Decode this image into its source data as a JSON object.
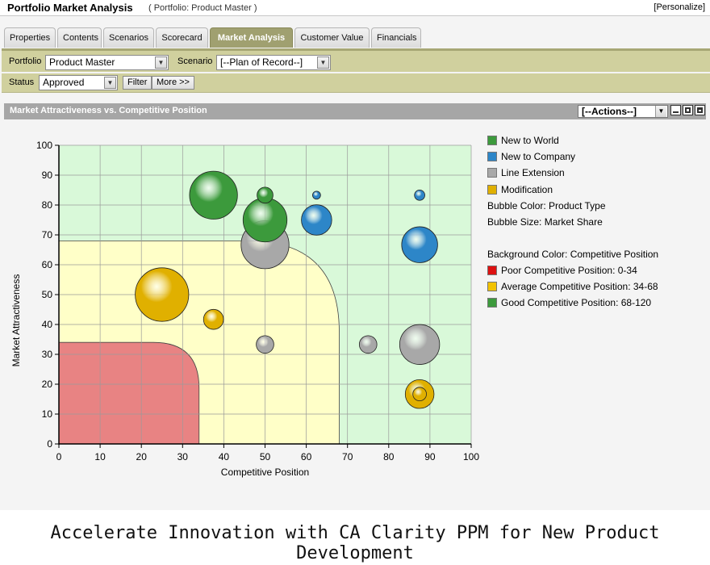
{
  "header": {
    "title": "Portfolio Market Analysis",
    "subtitle": "( Portfolio: Product Master )",
    "personalize": "[Personalize]"
  },
  "tabs": [
    {
      "label": "Properties"
    },
    {
      "label": "Contents"
    },
    {
      "label": "Scenarios"
    },
    {
      "label": "Scorecard"
    },
    {
      "label": "Market Analysis",
      "active": true
    },
    {
      "label": "Customer Value"
    },
    {
      "label": "Financials"
    }
  ],
  "filters": {
    "portfolio_label": "Portfolio",
    "portfolio_value": "Product Master",
    "scenario_label": "Scenario",
    "scenario_value": "[--Plan of Record--]",
    "status_label": "Status",
    "status_value": "Approved",
    "filter_button": "Filter",
    "more_button": "More >>"
  },
  "portlet": {
    "title": "Market Attractiveness vs. Competitive Position",
    "actions_value": "[--Actions--]"
  },
  "legend": {
    "types": [
      {
        "label": "New to World",
        "color": "#3c9a3c"
      },
      {
        "label": "New to Company",
        "color": "#2d86c8"
      },
      {
        "label": "Line Extension",
        "color": "#a8a8a8"
      },
      {
        "label": "Modification",
        "color": "#e0b000"
      }
    ],
    "bubble_color_note": "Bubble Color: Product Type",
    "bubble_size_note": "Bubble Size: Market Share",
    "background_title": "Background Color: Competitive Position",
    "zones": [
      {
        "label": "Poor Competitive Position: 0-34",
        "color": "#dd1111"
      },
      {
        "label": "Average Competitive Position: 34-68",
        "color": "#f2c200"
      },
      {
        "label": "Good Competitive Position: 68-120",
        "color": "#3c9a3c"
      }
    ]
  },
  "chart_data": {
    "type": "scatter",
    "xlabel": "Competitive Position",
    "ylabel": "Market Attractiveness",
    "xlim": [
      0,
      100
    ],
    "ylim": [
      0,
      100
    ],
    "x_ticks": [
      0,
      10,
      20,
      30,
      40,
      50,
      60,
      70,
      80,
      90,
      100
    ],
    "y_ticks": [
      0,
      10,
      20,
      30,
      40,
      50,
      60,
      70,
      80,
      90,
      100
    ],
    "grid": true,
    "legend_position": "right",
    "background_zones": [
      {
        "label": "Poor Competitive Position: 0-34",
        "max": 34,
        "color": "#e88383"
      },
      {
        "label": "Average Competitive Position: 34-68",
        "max": 68,
        "color": "#ffffc8"
      },
      {
        "label": "Good Competitive Position: 68-120",
        "max": 120,
        "color": "#d9f9d9"
      }
    ],
    "series": [
      {
        "name": "New to World",
        "color": "#3c9a3c",
        "points": [
          {
            "x": 37.5,
            "y": 83.3,
            "size": 6.0
          },
          {
            "x": 50,
            "y": 83.3,
            "size": 2.0
          },
          {
            "x": 50,
            "y": 75,
            "size": 5.5
          }
        ]
      },
      {
        "name": "New to Company",
        "color": "#2d86c8",
        "points": [
          {
            "x": 62.5,
            "y": 83.3,
            "size": 1.0
          },
          {
            "x": 62.5,
            "y": 75,
            "size": 3.8
          },
          {
            "x": 87.5,
            "y": 83.3,
            "size": 1.3
          },
          {
            "x": 87.5,
            "y": 66.7,
            "size": 4.5
          }
        ]
      },
      {
        "name": "Line Extension",
        "color": "#a8a8a8",
        "points": [
          {
            "x": 50,
            "y": 66.7,
            "size": 6.0
          },
          {
            "x": 50,
            "y": 33.3,
            "size": 2.2
          },
          {
            "x": 75,
            "y": 33.3,
            "size": 2.2
          },
          {
            "x": 87.5,
            "y": 33.3,
            "size": 5.0
          }
        ]
      },
      {
        "name": "Modification",
        "color": "#e0b000",
        "points": [
          {
            "x": 25,
            "y": 50,
            "size": 6.7
          },
          {
            "x": 37.5,
            "y": 41.7,
            "size": 2.5
          },
          {
            "x": 87.5,
            "y": 16.7,
            "size": 3.6
          },
          {
            "x": 87.5,
            "y": 16.7,
            "size": 1.7
          }
        ]
      }
    ]
  },
  "caption": "Accelerate Innovation with CA Clarity PPM for New Product Development"
}
